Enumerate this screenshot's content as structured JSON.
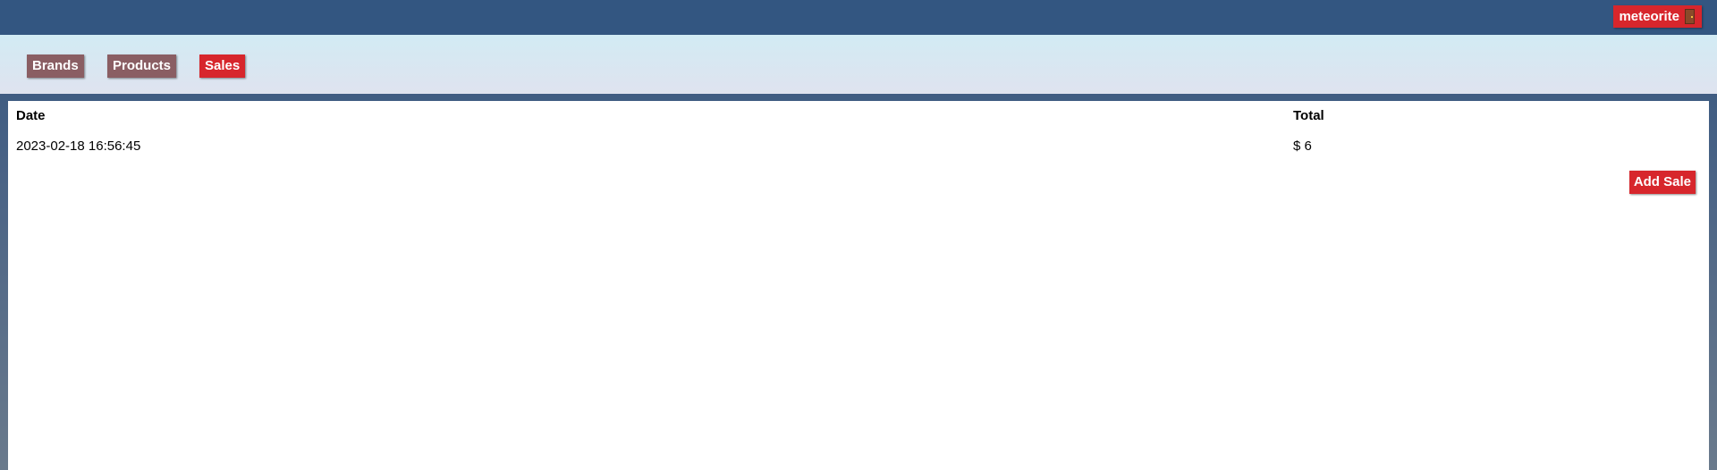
{
  "header": {
    "user_label": "meteorite",
    "logout_icon": "door-icon"
  },
  "nav": {
    "items": [
      {
        "label": "Brands",
        "active": false
      },
      {
        "label": "Products",
        "active": false
      },
      {
        "label": "Sales",
        "active": true
      }
    ]
  },
  "sales_table": {
    "columns": [
      "Date",
      "Total"
    ],
    "rows": [
      {
        "date": "2023-02-18 16:56:45",
        "total": "$ 6"
      }
    ]
  },
  "actions": {
    "add_sale_label": "Add Sale"
  },
  "colors": {
    "topbar": "#335681",
    "accent_red": "#d7262c",
    "nav_inactive": "#8a5e63"
  }
}
